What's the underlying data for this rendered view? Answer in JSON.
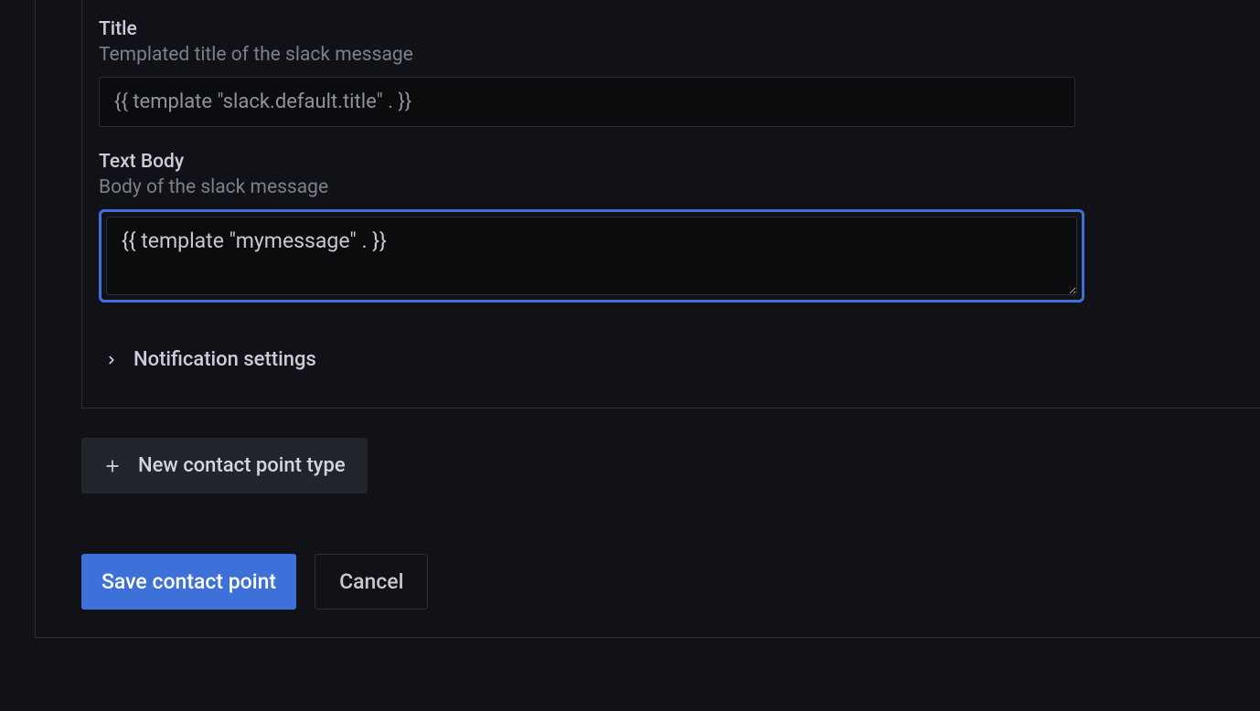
{
  "fields": {
    "title": {
      "label": "Title",
      "description": "Templated title of the slack message",
      "value": "{{ template \"slack.default.title\" . }}"
    },
    "textBody": {
      "label": "Text Body",
      "description": "Body of the slack message",
      "value": "{{ template \"mymessage\" . }}"
    }
  },
  "collapsible": {
    "notificationSettings": "Notification settings"
  },
  "buttons": {
    "newContactPointType": "New contact point type",
    "save": "Save contact point",
    "cancel": "Cancel"
  }
}
